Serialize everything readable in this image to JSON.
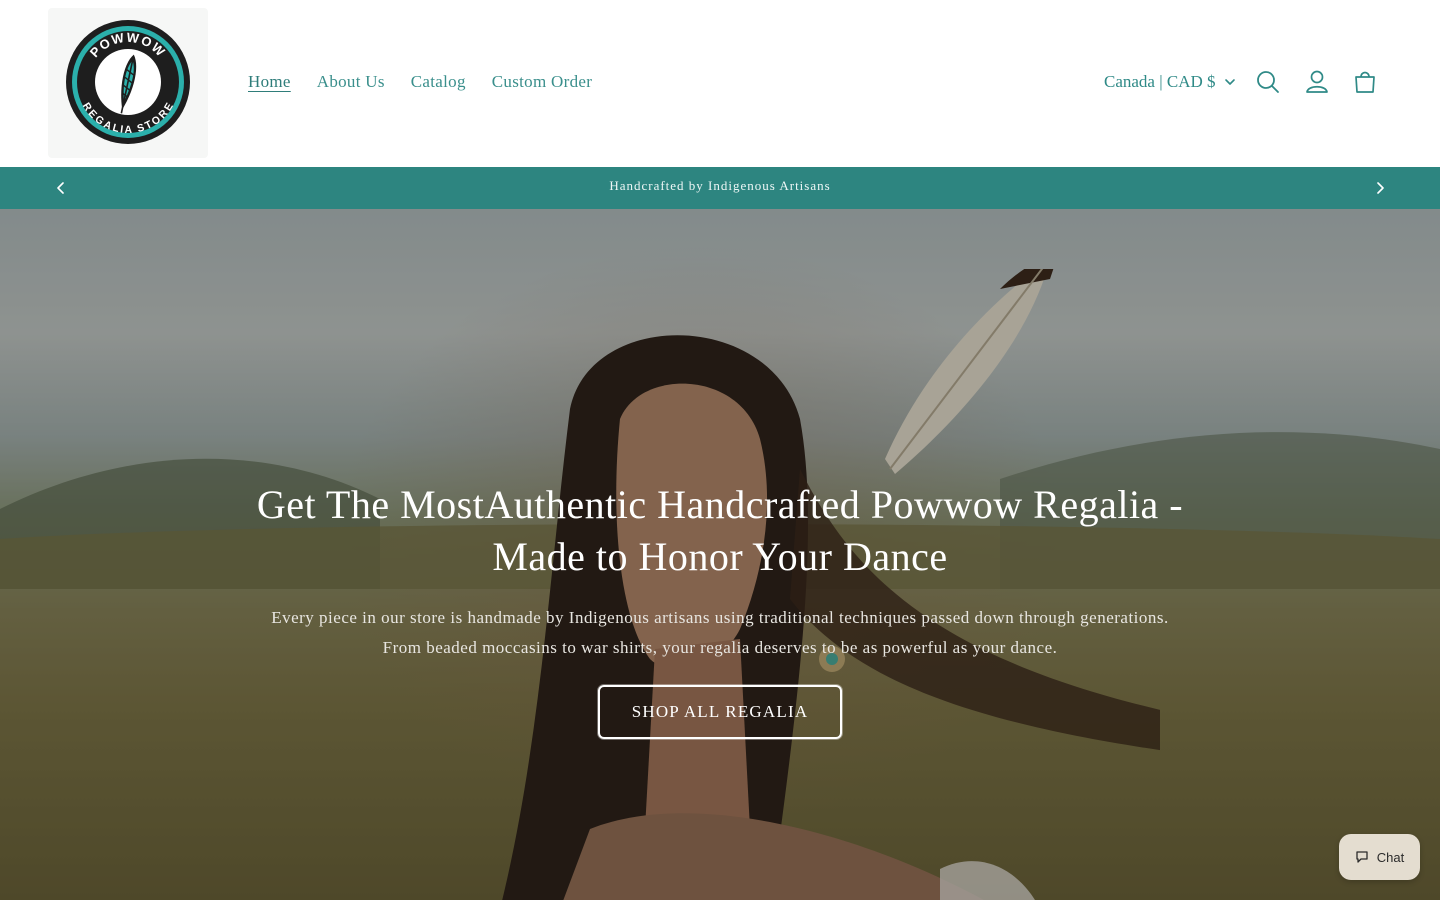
{
  "header": {
    "logo": {
      "top_text": "POWWOW",
      "bottom_text": "REGALIA STORE"
    },
    "nav": [
      {
        "label": "Home",
        "active": true
      },
      {
        "label": "About Us",
        "active": false
      },
      {
        "label": "Catalog",
        "active": false
      },
      {
        "label": "Custom Order",
        "active": false
      }
    ],
    "locale": {
      "label": "Canada | CAD $",
      "icon": "chevron-down-icon"
    },
    "icons": [
      "search-icon",
      "account-icon",
      "cart-icon"
    ]
  },
  "announcement": {
    "text": "Handcrafted by Indigenous Artisans",
    "prev_icon": "chevron-left-icon",
    "next_icon": "chevron-right-icon"
  },
  "hero": {
    "title": "Get The MostAuthentic Handcrafted Powwow Regalia - Made to Honor Your Dance",
    "subtitle_line1": "Every piece in our store is handmade by Indigenous artisans using traditional techniques passed down through generations.",
    "subtitle_line2": "From beaded moccasins to war shirts, your regalia deserves to be as powerful as your dance.",
    "button_label": "SHOP ALL REGALIA"
  },
  "chat": {
    "label": "Chat",
    "icon": "chat-bubble-icon"
  },
  "colors": {
    "accent": "#2d8580",
    "nav_text": "#3a8f8c",
    "logo_ring": "#2bb0ab"
  }
}
